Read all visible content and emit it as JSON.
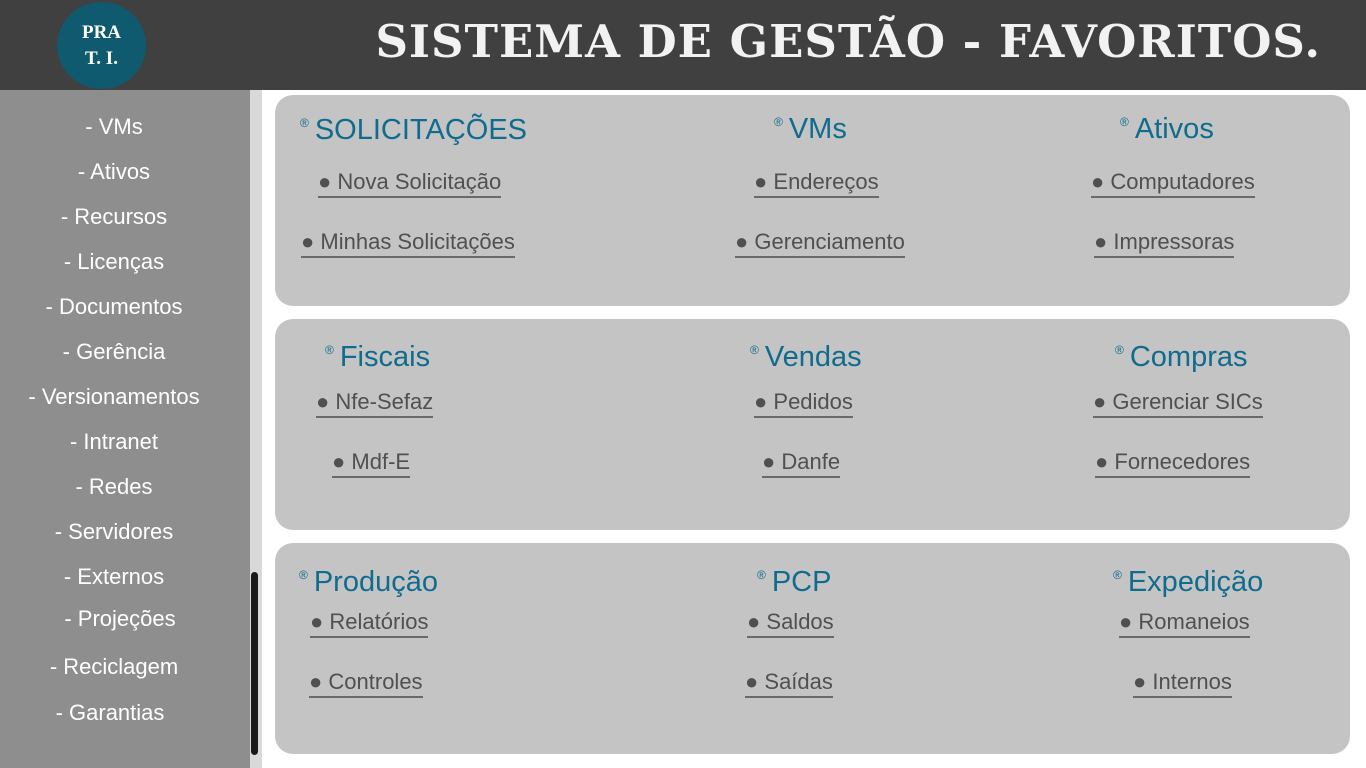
{
  "header": {
    "logo_line1": "PRA",
    "logo_line2": "T. I.",
    "title": "SISTEMA DE GESTÃO - FAVORITOS."
  },
  "sidebar": {
    "items": [
      {
        "label": "- VMs"
      },
      {
        "label": "- Ativos"
      },
      {
        "label": "- Recursos"
      },
      {
        "label": "- Licenças"
      },
      {
        "label": "- Documentos"
      },
      {
        "label": "- Gerência"
      },
      {
        "label": "- Versionamentos"
      },
      {
        "label": "- Intranet"
      },
      {
        "label": "- Redes"
      },
      {
        "label": "- Servidores"
      },
      {
        "label": "- Externos"
      },
      {
        "label": "- Projeções"
      },
      {
        "label": "- Reciclagem"
      },
      {
        "label": "- Garantias"
      }
    ]
  },
  "reg_symbol": "®",
  "panels": [
    {
      "categories": [
        {
          "title": "SOLICITAÇÕES",
          "links": [
            "● Nova Solicitação",
            "● Minhas Solicitações"
          ]
        },
        {
          "title": "VMs",
          "links": [
            "● Endereços",
            "● Gerenciamento"
          ]
        },
        {
          "title": "Ativos",
          "links": [
            "● Computadores",
            "● Impressoras"
          ]
        }
      ]
    },
    {
      "categories": [
        {
          "title": "Fiscais",
          "links": [
            "● Nfe-Sefaz",
            "● Mdf-E"
          ]
        },
        {
          "title": "Vendas",
          "links": [
            "● Pedidos",
            "● Danfe"
          ]
        },
        {
          "title": "Compras",
          "links": [
            "● Gerenciar SICs",
            "● Fornecedores"
          ]
        }
      ]
    },
    {
      "categories": [
        {
          "title": "Produção",
          "links": [
            "● Relatórios",
            "● Controles"
          ]
        },
        {
          "title": "PCP",
          "links": [
            "● Saldos",
            "● Saídas"
          ]
        },
        {
          "title": "Expedição",
          "links": [
            "● Romaneios",
            "● Internos"
          ]
        }
      ]
    }
  ],
  "colors": {
    "header_bg": "#404040",
    "logo_bg": "#0f5a6e",
    "sidebar_bg": "#8e8e8e",
    "panel_bg": "#c4c4c4",
    "category_title": "#106c8e",
    "link_text": "#505050"
  }
}
